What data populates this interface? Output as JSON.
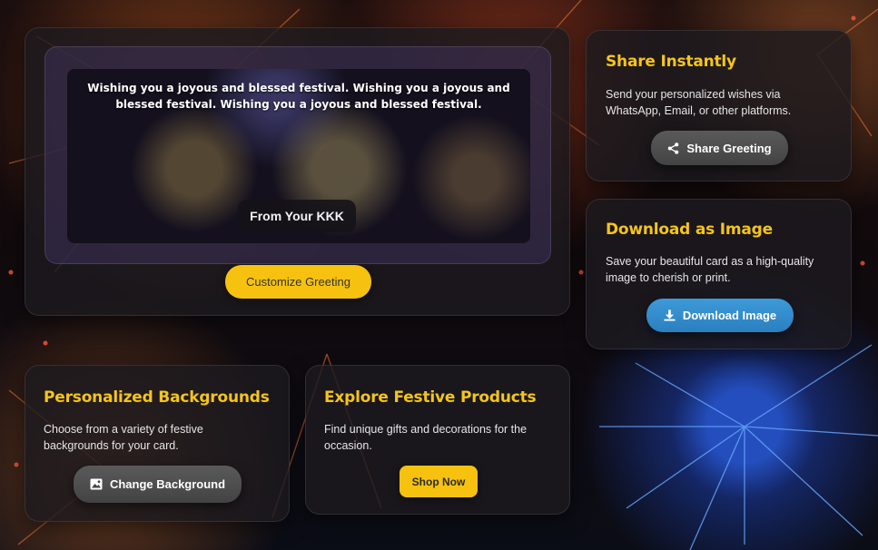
{
  "preview": {
    "wish_text": "Wishing you a joyous and blessed festival. Wishing you a joyous and blessed festival. Wishing you a joyous and blessed festival.",
    "from_text": "From Your KKK",
    "customize_label": "Customize Greeting"
  },
  "share": {
    "title": "Share Instantly",
    "description": "Send your personalized wishes via WhatsApp, Email, or other platforms.",
    "button_label": "Share Greeting",
    "icon": "share-icon"
  },
  "download": {
    "title": "Download as Image",
    "description": "Save your beautiful card as a high-quality image to cherish or print.",
    "button_label": "Download Image",
    "icon": "download-icon"
  },
  "backgrounds": {
    "title": "Personalized Backgrounds",
    "description": "Choose from a variety of festive backgrounds for your card.",
    "button_label": "Change Background",
    "icon": "image-icon"
  },
  "products": {
    "title": "Explore Festive Products",
    "description": "Find unique gifts and decorations for the occasion.",
    "button_label": "Shop Now"
  },
  "colors": {
    "accent_yellow": "#f6c20f",
    "heading_yellow": "#f5c518",
    "download_blue": "#2b7fbf",
    "button_grey": "#4a4a4a"
  }
}
